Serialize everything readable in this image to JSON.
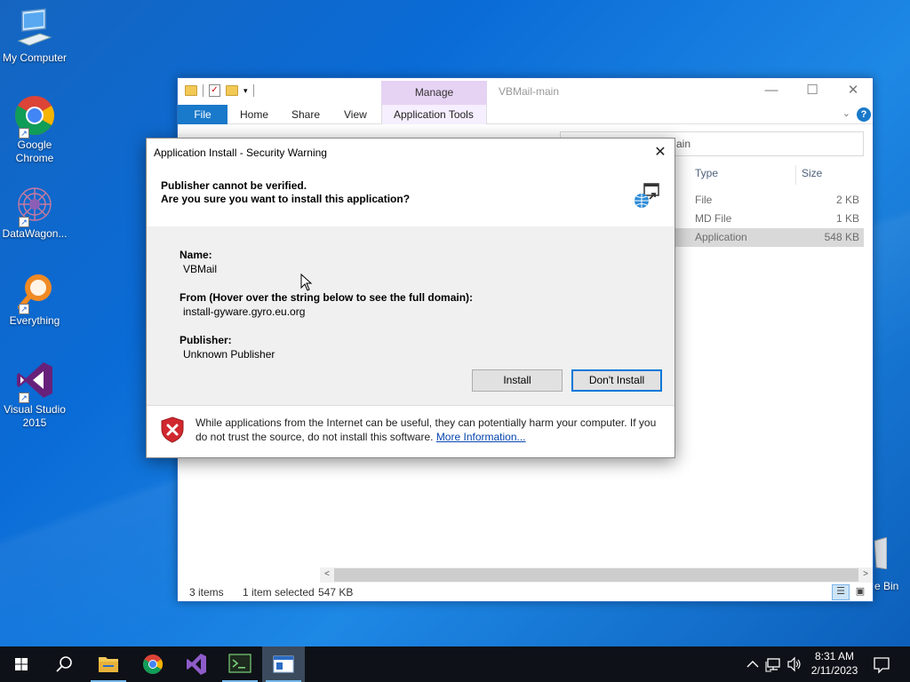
{
  "desktop": {
    "icons": [
      {
        "label": "My Computer"
      },
      {
        "label": "Google Chrome"
      },
      {
        "label": "DataWagon..."
      },
      {
        "label": "Everything"
      },
      {
        "label": "Visual Studio 2015"
      }
    ],
    "recycle_bin_partial_label": "e Bin"
  },
  "explorer": {
    "title": "VBMail-main",
    "contextual_tab": "Manage",
    "ribbon_tabs": [
      "File",
      "Home",
      "Share",
      "View",
      "Application Tools"
    ],
    "search_partial": "ain",
    "columns": {
      "type": "Type",
      "size": "Size"
    },
    "files": [
      {
        "type": "File",
        "size": "2 KB"
      },
      {
        "type": "MD File",
        "size": "1 KB"
      },
      {
        "type": "Application",
        "size": "548 KB"
      }
    ],
    "status": {
      "items": "3 items",
      "selected": "1 item selected",
      "sel_size": "547 KB"
    }
  },
  "dialog": {
    "title": "Application Install - Security Warning",
    "header_line1": "Publisher cannot be verified.",
    "header_line2": "Are you sure you want to install this application?",
    "name_label": "Name:",
    "name_value": "VBMail",
    "from_label": "From (Hover over the string below to see the full domain):",
    "from_value": "install-gyware.gyro.eu.org",
    "publisher_label": "Publisher:",
    "publisher_value": "Unknown Publisher",
    "install_button": "Install",
    "dont_install_button": "Don't Install",
    "footer_text": "While applications from the Internet can be useful, they can potentially harm your computer. If you do not trust the source, do not install this software.",
    "footer_link": "More Information..."
  },
  "taskbar": {
    "pinned": [
      "start",
      "search",
      "file-explorer",
      "chrome",
      "visual-studio",
      "terminal-app",
      "application-install"
    ],
    "time": "8:31 AM",
    "date": "2/11/2023"
  },
  "colors": {
    "desktop": "#1565c0",
    "accent": "#0078d7",
    "file_tab": "#1979ca",
    "manage_tab": "#e6d2f3",
    "taskbar": "#0e1117"
  }
}
